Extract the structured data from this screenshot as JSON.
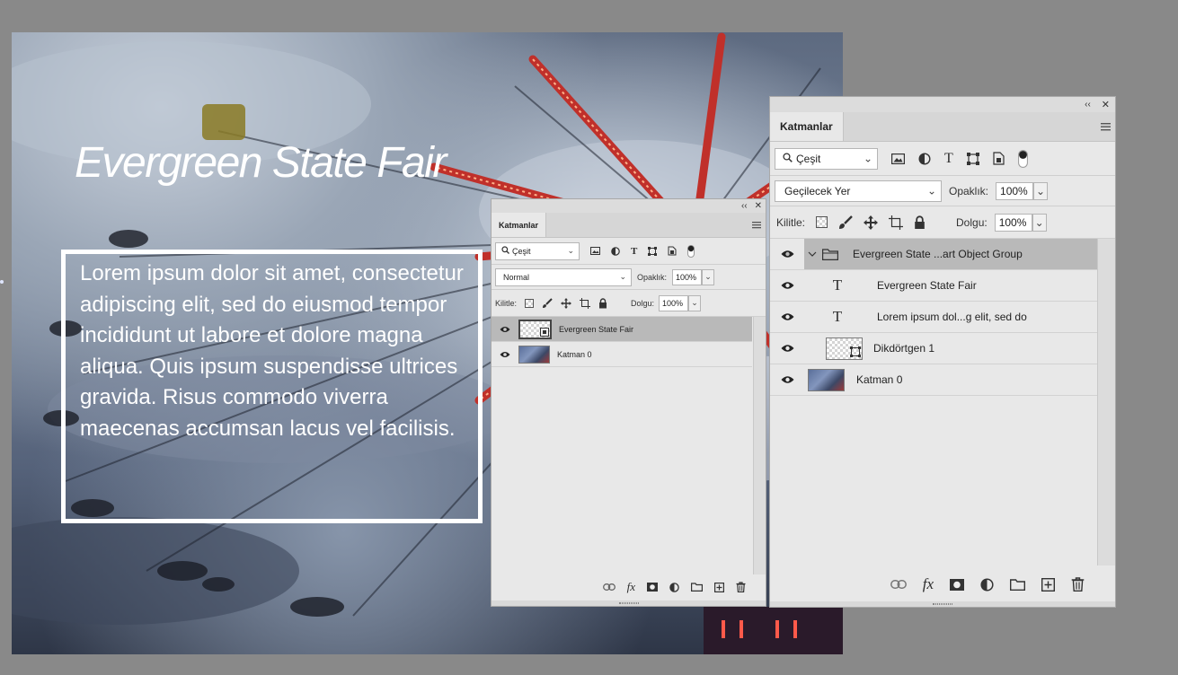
{
  "canvas": {
    "title": "Evergreen State Fair",
    "body": "Lorem ipsum dolor sit amet, consectetur adipiscing elit, sed do eiusmod tempor incididunt ut labore et dolore magna aliqua. Quis ipsum suspendisse ultrices gravida. Risus commodo viverra maecenas accumsan lacus vel facilisis."
  },
  "panel_small": {
    "collapse_glyph": "‹‹",
    "close_glyph": "✕",
    "tab_label": "Katmanlar",
    "filter_label": "Çeşit",
    "blend_mode": "Normal",
    "opacity_label": "Opaklık:",
    "opacity_value": "100%",
    "lock_label": "Kilitle:",
    "fill_label": "Dolgu:",
    "fill_value": "100%",
    "layers": [
      {
        "name": "Evergreen State Fair",
        "kind": "smart-object",
        "selected": true
      },
      {
        "name": "Katman 0",
        "kind": "photo",
        "selected": false
      }
    ]
  },
  "panel_large": {
    "collapse_glyph": "‹‹",
    "close_glyph": "✕",
    "tab_label": "Katmanlar",
    "filter_label": "Çeşit",
    "blend_mode": "Geçilecek Yer",
    "opacity_label": "Opaklık:",
    "opacity_value": "100%",
    "lock_label": "Kilitle:",
    "fill_label": "Dolgu:",
    "fill_value": "100%",
    "layers": [
      {
        "name": "Evergreen State ...art Object Group",
        "kind": "group",
        "selected": true
      },
      {
        "name": "Evergreen State Fair",
        "kind": "text",
        "selected": false
      },
      {
        "name": "Lorem ipsum dol...g elit, sed do",
        "kind": "text",
        "selected": false
      },
      {
        "name": "Dikdörtgen 1",
        "kind": "shape",
        "selected": false
      },
      {
        "name": "Katman 0",
        "kind": "photo",
        "selected": false
      }
    ]
  },
  "icons": {
    "chevron": "⌄",
    "text_layer_glyph": "T",
    "fx_glyph": "fx"
  },
  "colors": {
    "panel_bg": "#e8e8e8",
    "selected_row": "#b9b9b9",
    "workspace": "#898989"
  }
}
